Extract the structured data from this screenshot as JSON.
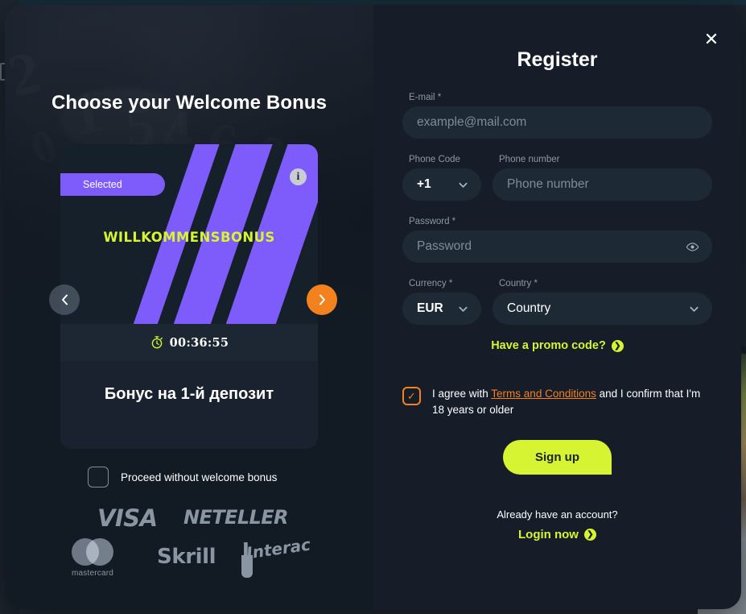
{
  "left": {
    "heading": "Choose your Welcome Bonus",
    "bonus_card": {
      "badge": "Selected",
      "info_icon": "info-icon",
      "wordmark": "WILLKOMMENSBONUS",
      "timer_icon": "stopwatch-icon",
      "timer": "00:36:55",
      "name": "Бонус на 1-й депозит",
      "accent_purple": "#7d5cfb",
      "accent_lime": "#d6f431"
    },
    "carousel": {
      "prev_icon": "chevron-left-icon",
      "next_icon": "chevron-right-icon",
      "next_color": "#f2811e"
    },
    "proceed": {
      "label": "Proceed without welcome bonus",
      "checked": false
    },
    "payments": [
      {
        "name": "VISA",
        "id": "visa-logo"
      },
      {
        "name": "NETELLER",
        "id": "neteller-logo"
      },
      {
        "name": "mastercard",
        "id": "mastercard-logo"
      },
      {
        "name": "Skrill",
        "id": "skrill-logo"
      },
      {
        "name": "Interac",
        "id": "interac-logo"
      }
    ]
  },
  "right": {
    "title": "Register",
    "close_icon": "close-icon",
    "email": {
      "label": "E-mail *",
      "placeholder": "example@mail.com",
      "value": ""
    },
    "phone_code": {
      "label": "Phone Code",
      "value": "+1"
    },
    "phone_number": {
      "label": "Phone number",
      "placeholder": "Phone number",
      "value": ""
    },
    "password": {
      "label": "Password *",
      "placeholder": "Password",
      "value": "",
      "toggle_icon": "eye-icon"
    },
    "currency": {
      "label": "Currency *",
      "value": "EUR"
    },
    "country": {
      "label": "Country *",
      "value": "Country"
    },
    "promo": {
      "text": "Have a promo code?",
      "arrow": "❯",
      "color": "#d6f431"
    },
    "terms": {
      "checked": true,
      "check_glyph": "✓",
      "before_link": "I agree with ",
      "link": "Terms and Conditions",
      "after_link": " and I confirm that I'm 18 years or older",
      "accent": "#f2811e"
    },
    "signup_button": "Sign up",
    "already_account": "Already have an account?",
    "login_now": "Login now",
    "login_arrow": "❯"
  }
}
